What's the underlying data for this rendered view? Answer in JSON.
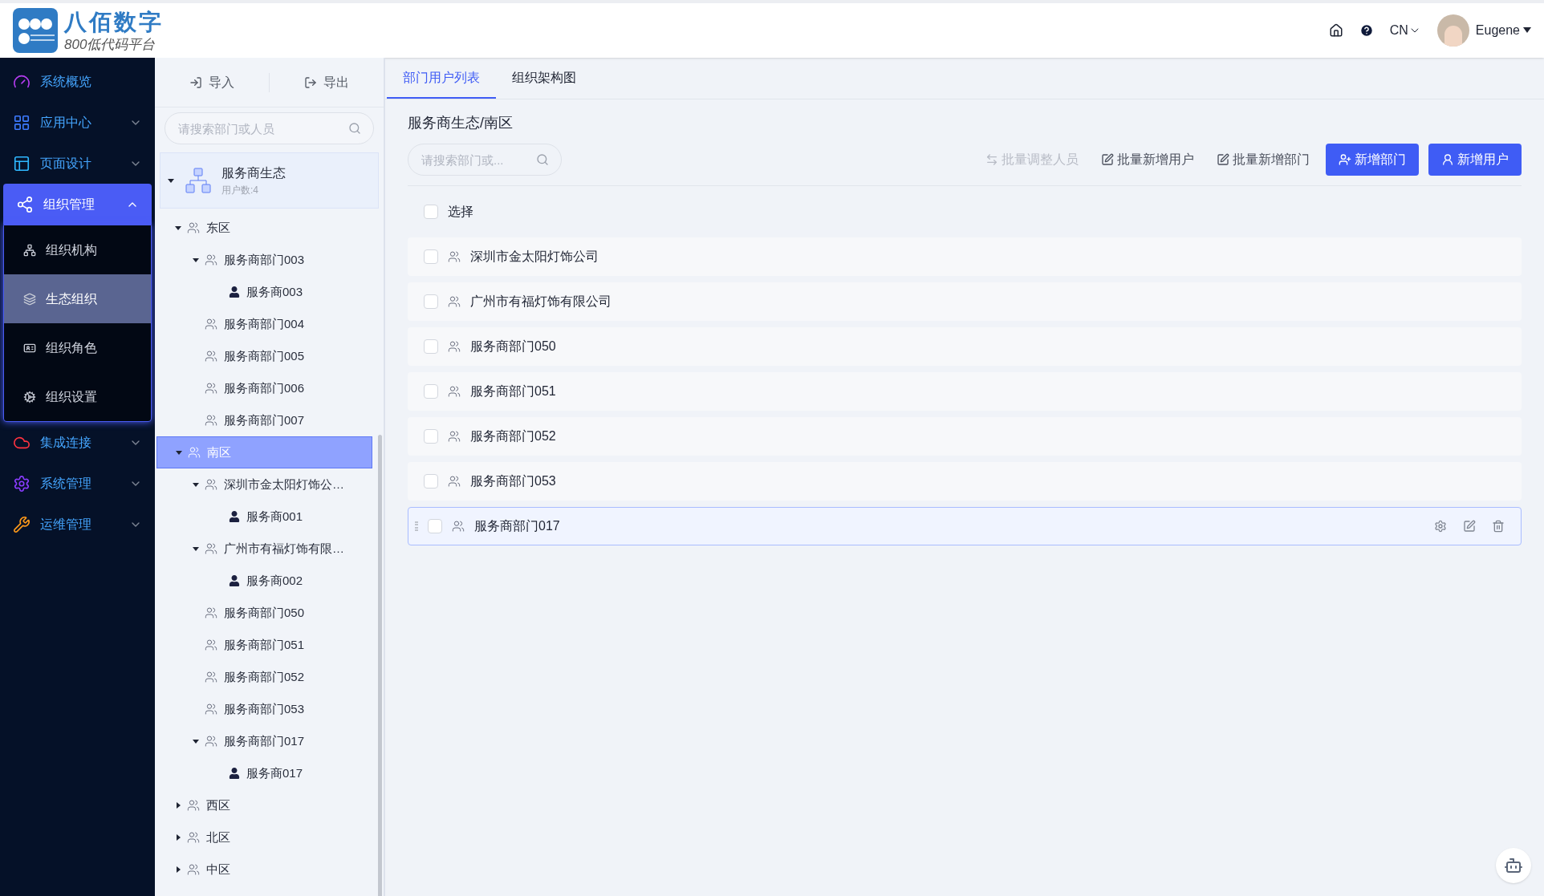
{
  "header": {
    "brand": "八佰数字",
    "tagline": "800低代码平台",
    "language": "CN",
    "user": "Eugene"
  },
  "sidebar": [
    {
      "label": "系统概览",
      "selected": false
    },
    {
      "label": "应用中心",
      "selected": false,
      "expanded": false
    },
    {
      "label": "页面设计",
      "selected": false,
      "expanded": false
    },
    {
      "label": "组织管理",
      "selected": true,
      "expanded": true,
      "children": [
        {
          "label": "组织机构",
          "selected": false
        },
        {
          "label": "生态组织",
          "selected": true
        },
        {
          "label": "组织角色",
          "selected": false
        },
        {
          "label": "组织设置",
          "selected": false
        }
      ]
    },
    {
      "label": "集成连接",
      "selected": false,
      "expanded": false
    },
    {
      "label": "系统管理",
      "selected": false,
      "expanded": false
    },
    {
      "label": "运维管理",
      "selected": false,
      "expanded": false
    }
  ],
  "tree_panel": {
    "buttons": [
      "导入",
      "导出"
    ],
    "search": {
      "placeholder": "请搜索部门或人员"
    },
    "root": {
      "title": "服务商生态",
      "subtitle": "用户数:4",
      "expanded": true
    },
    "nodes": [
      {
        "label": "东区",
        "kind": "dept",
        "expanded": true,
        "selected": false,
        "children": [
          {
            "label": "服务商部门003",
            "kind": "dept",
            "expanded": true,
            "selected": false,
            "children": [
              {
                "label": "服务商003",
                "kind": "user",
                "selected": false
              }
            ]
          },
          {
            "label": "服务商部门004",
            "kind": "dept",
            "selected": false
          },
          {
            "label": "服务商部门005",
            "kind": "dept",
            "selected": false
          },
          {
            "label": "服务商部门006",
            "kind": "dept",
            "selected": false
          },
          {
            "label": "服务商部门007",
            "kind": "dept",
            "selected": false
          }
        ]
      },
      {
        "label": "南区",
        "kind": "dept",
        "expanded": true,
        "selected": true,
        "children": [
          {
            "label": "深圳市金太阳灯饰公…",
            "kind": "dept",
            "expanded": true,
            "selected": false,
            "children": [
              {
                "label": "服务商001",
                "kind": "user",
                "selected": false
              }
            ]
          },
          {
            "label": "广州市有福灯饰有限…",
            "kind": "dept",
            "expanded": true,
            "selected": false,
            "children": [
              {
                "label": "服务商002",
                "kind": "user",
                "selected": false
              }
            ]
          },
          {
            "label": "服务商部门050",
            "kind": "dept",
            "selected": false
          },
          {
            "label": "服务商部门051",
            "kind": "dept",
            "selected": false
          },
          {
            "label": "服务商部门052",
            "kind": "dept",
            "selected": false
          },
          {
            "label": "服务商部门053",
            "kind": "dept",
            "selected": false
          },
          {
            "label": "服务商部门017",
            "kind": "dept",
            "expanded": true,
            "selected": false,
            "children": [
              {
                "label": "服务商017",
                "kind": "user",
                "selected": false
              }
            ]
          }
        ]
      },
      {
        "label": "西区",
        "kind": "dept",
        "expanded": false,
        "selected": false
      },
      {
        "label": "北区",
        "kind": "dept",
        "expanded": false,
        "selected": false
      },
      {
        "label": "中区",
        "kind": "dept",
        "expanded": false,
        "selected": false
      }
    ]
  },
  "tabs": [
    {
      "label": "部门用户列表",
      "selected": true
    },
    {
      "label": "组织架构图",
      "selected": false
    }
  ],
  "breadcrumb": "服务商生态/南区",
  "search": {
    "placeholder": "请搜索部门或..."
  },
  "toolbar": [
    {
      "label": "批量调整人员",
      "kind": "link",
      "disabled": true
    },
    {
      "label": "批量新增用户",
      "kind": "link",
      "disabled": false
    },
    {
      "label": "批量新增部门",
      "kind": "link",
      "disabled": false
    },
    {
      "label": "新增部门",
      "kind": "primary"
    },
    {
      "label": "新增用户",
      "kind": "primary"
    }
  ],
  "select_all": {
    "label": "选择",
    "checked": false
  },
  "rows": [
    {
      "label": "深圳市金太阳灯饰公司",
      "checked": false,
      "highlighted": false
    },
    {
      "label": "广州市有福灯饰有限公司",
      "checked": false,
      "highlighted": false
    },
    {
      "label": "服务商部门050",
      "checked": false,
      "highlighted": false
    },
    {
      "label": "服务商部门051",
      "checked": false,
      "highlighted": false
    },
    {
      "label": "服务商部门052",
      "checked": false,
      "highlighted": false
    },
    {
      "label": "服务商部门053",
      "checked": false,
      "highlighted": false
    },
    {
      "label": "服务商部门017",
      "checked": false,
      "highlighted": true
    }
  ]
}
